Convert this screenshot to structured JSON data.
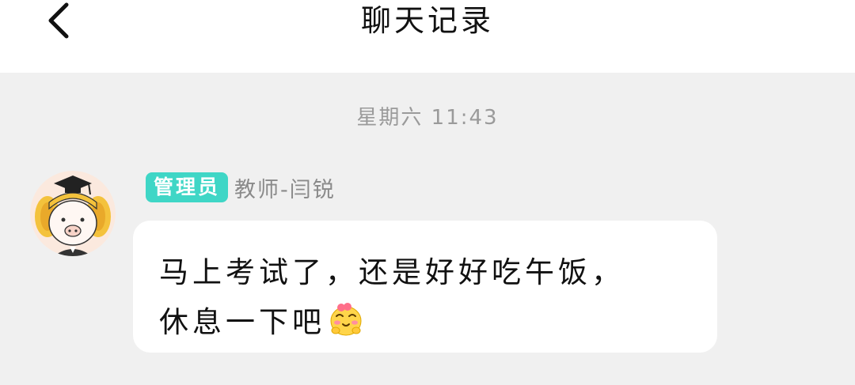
{
  "header": {
    "title": "聊天记录",
    "back_icon": "chevron-left-icon"
  },
  "chat": {
    "timestamp": "星期六 11:43",
    "message": {
      "sender": {
        "avatar_icon": "pig-graduate-avatar",
        "role_badge": "管理员",
        "name": "教师-闫锐"
      },
      "text_line1": "马上考试了，还是好好吃午饭，",
      "text_line2": "休息一下吧",
      "emoji_icon": "cute-blushing-face-emoji"
    }
  },
  "colors": {
    "chat_background": "#f0f0f0",
    "bubble": "#ffffff",
    "role_badge": "#3fd6c6",
    "timestamp_text": "#9a9a9a",
    "sender_name_text": "#8a8a8a"
  }
}
